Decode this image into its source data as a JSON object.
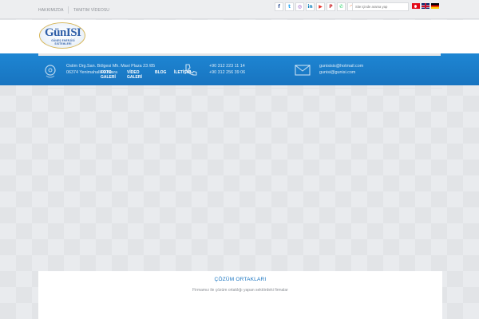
{
  "topbar": {
    "links": [
      "HAKKIMIZDA",
      "TANITIM VİDEOSU"
    ],
    "social_icons": [
      {
        "name": "facebook-icon",
        "glyph": "f",
        "color": "#3b5998"
      },
      {
        "name": "twitter-icon",
        "glyph": "t",
        "color": "#1da1f2"
      },
      {
        "name": "instagram-icon",
        "glyph": "◎",
        "color": "#8a3ab9"
      },
      {
        "name": "linkedin-icon",
        "glyph": "in",
        "color": "#0077b5"
      },
      {
        "name": "youtube-icon",
        "glyph": "▶",
        "color": "#e52d27"
      },
      {
        "name": "pinterest-icon",
        "glyph": "P",
        "color": "#cb2027"
      },
      {
        "name": "whatsapp-icon",
        "glyph": "✆",
        "color": "#25d366"
      },
      {
        "name": "rss-icon",
        "glyph": "◠",
        "color": "#f26522"
      }
    ],
    "search_placeholder": "Site içinde arama yap",
    "flags": [
      "turkish-flag-icon",
      "uk-flag-icon",
      "german-flag-icon"
    ]
  },
  "logo": {
    "main": "GünISI",
    "sub_line1": "GÜNEŞ ENERJİSİ",
    "sub_line2": "SİSTEMLERİ"
  },
  "nav": {
    "items": [
      "FOTO",
      "GALERİ",
      "VİDEO",
      "GALERİ",
      "BLOG",
      "İLETİŞİM"
    ]
  },
  "contact": {
    "address_line1": "Ostim Org.San. Bölgesi Mh. Mavi Plaza 23 /85",
    "address_line2": "06374 Yenimahalle/Ankara",
    "phone_line1": "+90 312 223 11 14",
    "phone_line2": "+90 312 256 39 06",
    "email_line1": "gunisisis@hotmail.com",
    "email_line2": "gunisi@gunisi.com"
  },
  "content": {
    "title": "ÇÖZÜM ORTAKLARI",
    "subtitle": "Firmamız ile çözüm ortaklığı yapan sektördeki firmalar"
  },
  "colors": {
    "primary": "#1874c0",
    "accent": "#1e86d3"
  }
}
